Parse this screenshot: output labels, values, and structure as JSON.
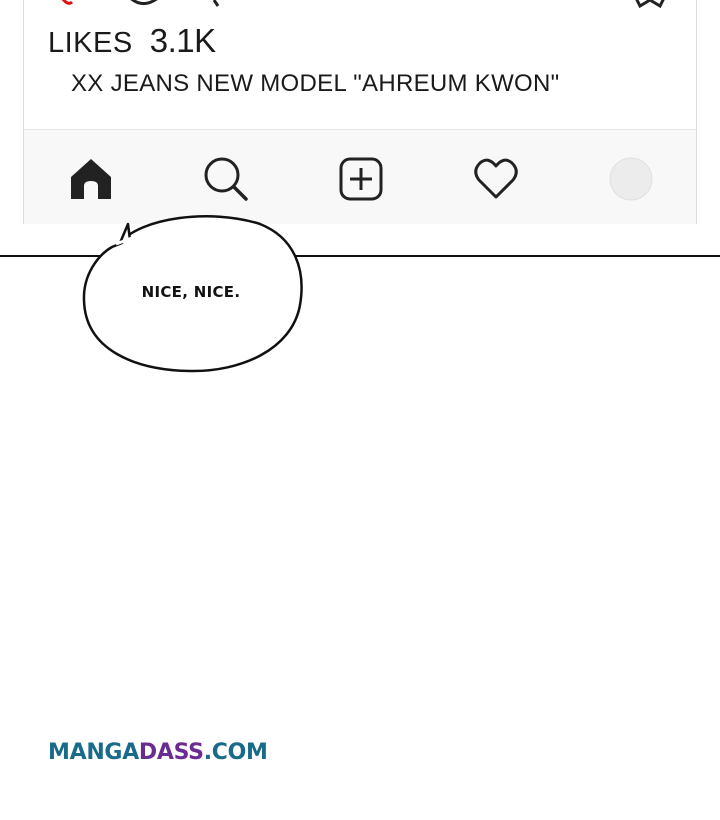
{
  "post": {
    "likes_label": "LIKES",
    "likes_count": "3.1K",
    "caption": "XX JEANS NEW MODEL \"AHREUM KWON\""
  },
  "nav": {
    "items": [
      "home-icon",
      "search-icon",
      "add-post-icon",
      "heart-icon",
      "profile-avatar"
    ]
  },
  "speech_bubble": {
    "text": "NICE, NICE."
  },
  "watermark": {
    "part1": "MANGA",
    "part2": "DASS",
    "part3": ".COM",
    "colors": [
      "#1a6b8a",
      "#6a2c91",
      "#1a6b8a"
    ]
  },
  "colors": {
    "nav_background": "#f8f8f8",
    "icon_color": "#222222",
    "avatar_color": "#ececec"
  }
}
